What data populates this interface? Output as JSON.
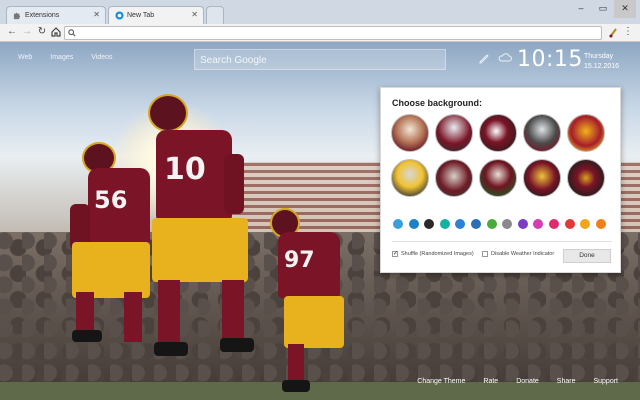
{
  "tabs": [
    {
      "label": "Extensions",
      "icon": "puzzle-icon"
    },
    {
      "label": "New Tab",
      "icon": "app-icon"
    }
  ],
  "toolbar": {
    "address": ""
  },
  "ntp": {
    "toplinks": [
      "Web",
      "Images",
      "Videos"
    ],
    "search_placeholder": "Search Google",
    "clock": "10:15",
    "day": "Thursday",
    "date": "15.12.2016"
  },
  "background_photo": {
    "jersey_numbers": [
      "56",
      "10",
      "97"
    ]
  },
  "panel": {
    "title": "Choose background:",
    "thumbnails": [
      {
        "name": "thumb-1"
      },
      {
        "name": "thumb-2"
      },
      {
        "name": "thumb-3"
      },
      {
        "name": "thumb-4"
      },
      {
        "name": "thumb-5"
      },
      {
        "name": "thumb-6"
      },
      {
        "name": "thumb-7"
      },
      {
        "name": "thumb-8"
      },
      {
        "name": "thumb-9"
      },
      {
        "name": "thumb-10"
      }
    ],
    "swatches": [
      "#3aa0dc",
      "#1c82c8",
      "#2a2a2a",
      "#12b2a0",
      "#2e7fd6",
      "#2d6fb5",
      "#4aab3c",
      "#8a8a8a",
      "#7b3ec1",
      "#d43db6",
      "#e02a6d",
      "#e23838",
      "#f0a51a",
      "#f07f1a"
    ],
    "options": [
      {
        "label": "Shuffle (Randomized Images)",
        "checked": true,
        "check_glyph": "✓"
      },
      {
        "label": "Disable Weather Indicator",
        "checked": false,
        "check_glyph": ""
      }
    ],
    "done_label": "Done"
  },
  "footer": [
    "Change Theme",
    "Rate",
    "Donate",
    "Share",
    "Support"
  ],
  "colors": {
    "accent": "#7a1426",
    "gold": "#e8b21f"
  }
}
